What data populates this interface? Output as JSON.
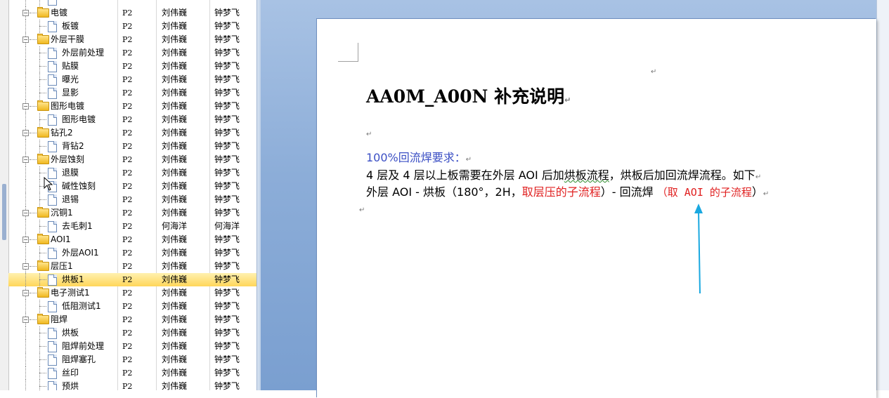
{
  "tree": {
    "rows": [
      {
        "label": "",
        "code": "",
        "owner": "",
        "reviewer": "",
        "level": 1,
        "type": "doc"
      },
      {
        "label": "电镀",
        "code": "P2",
        "owner": "刘伟巍",
        "reviewer": "钟梦飞",
        "level": 0,
        "type": "folder"
      },
      {
        "label": "板镀",
        "code": "P2",
        "owner": "刘伟巍",
        "reviewer": "钟梦飞",
        "level": 1,
        "type": "doc"
      },
      {
        "label": "外层干膜",
        "code": "P2",
        "owner": "刘伟巍",
        "reviewer": "钟梦飞",
        "level": 0,
        "type": "folder"
      },
      {
        "label": "外层前处理",
        "code": "P2",
        "owner": "刘伟巍",
        "reviewer": "钟梦飞",
        "level": 1,
        "type": "doc"
      },
      {
        "label": "贴膜",
        "code": "P2",
        "owner": "刘伟巍",
        "reviewer": "钟梦飞",
        "level": 1,
        "type": "doc"
      },
      {
        "label": "曝光",
        "code": "P2",
        "owner": "刘伟巍",
        "reviewer": "钟梦飞",
        "level": 1,
        "type": "doc"
      },
      {
        "label": "显影",
        "code": "P2",
        "owner": "刘伟巍",
        "reviewer": "钟梦飞",
        "level": 1,
        "type": "doc"
      },
      {
        "label": "图形电镀",
        "code": "P2",
        "owner": "刘伟巍",
        "reviewer": "钟梦飞",
        "level": 0,
        "type": "folder"
      },
      {
        "label": "图形电镀",
        "code": "P2",
        "owner": "刘伟巍",
        "reviewer": "钟梦飞",
        "level": 1,
        "type": "doc"
      },
      {
        "label": "钻孔2",
        "code": "P2",
        "owner": "刘伟巍",
        "reviewer": "钟梦飞",
        "level": 0,
        "type": "folder"
      },
      {
        "label": "背钻2",
        "code": "P2",
        "owner": "刘伟巍",
        "reviewer": "钟梦飞",
        "level": 1,
        "type": "doc"
      },
      {
        "label": "外层蚀刻",
        "code": "P2",
        "owner": "刘伟巍",
        "reviewer": "钟梦飞",
        "level": 0,
        "type": "folder"
      },
      {
        "label": "退膜",
        "code": "P2",
        "owner": "刘伟巍",
        "reviewer": "钟梦飞",
        "level": 1,
        "type": "doc"
      },
      {
        "label": "碱性蚀刻",
        "code": "P2",
        "owner": "刘伟巍",
        "reviewer": "钟梦飞",
        "level": 1,
        "type": "doc"
      },
      {
        "label": "退锡",
        "code": "P2",
        "owner": "刘伟巍",
        "reviewer": "钟梦飞",
        "level": 1,
        "type": "doc"
      },
      {
        "label": "沉铜1",
        "code": "P2",
        "owner": "刘伟巍",
        "reviewer": "钟梦飞",
        "level": 0,
        "type": "folder"
      },
      {
        "label": "去毛刺1",
        "code": "P2",
        "owner": "何海洋",
        "reviewer": "何海洋",
        "level": 1,
        "type": "doc"
      },
      {
        "label": "AOI1",
        "code": "P2",
        "owner": "刘伟巍",
        "reviewer": "钟梦飞",
        "level": 0,
        "type": "folder"
      },
      {
        "label": "外层AOI1",
        "code": "P2",
        "owner": "刘伟巍",
        "reviewer": "钟梦飞",
        "level": 1,
        "type": "doc"
      },
      {
        "label": "层压1",
        "code": "P2",
        "owner": "刘伟巍",
        "reviewer": "钟梦飞",
        "level": 0,
        "type": "folder"
      },
      {
        "label": "烘板1",
        "code": "P2",
        "owner": "刘伟巍",
        "reviewer": "钟梦飞",
        "level": 1,
        "type": "doc",
        "selected": true
      },
      {
        "label": "电子测试1",
        "code": "P2",
        "owner": "刘伟巍",
        "reviewer": "钟梦飞",
        "level": 0,
        "type": "folder"
      },
      {
        "label": "低阻测试1",
        "code": "P2",
        "owner": "刘伟巍",
        "reviewer": "钟梦飞",
        "level": 1,
        "type": "doc"
      },
      {
        "label": "阻焊",
        "code": "P2",
        "owner": "刘伟巍",
        "reviewer": "钟梦飞",
        "level": 0,
        "type": "folder"
      },
      {
        "label": "烘板",
        "code": "P2",
        "owner": "刘伟巍",
        "reviewer": "钟梦飞",
        "level": 1,
        "type": "doc"
      },
      {
        "label": "阻焊前处理",
        "code": "P2",
        "owner": "刘伟巍",
        "reviewer": "钟梦飞",
        "level": 1,
        "type": "doc"
      },
      {
        "label": "阻焊塞孔",
        "code": "P2",
        "owner": "刘伟巍",
        "reviewer": "钟梦飞",
        "level": 1,
        "type": "doc"
      },
      {
        "label": "丝印",
        "code": "P2",
        "owner": "刘伟巍",
        "reviewer": "钟梦飞",
        "level": 1,
        "type": "doc"
      },
      {
        "label": "预烘",
        "code": "P2",
        "owner": "刘伟巍",
        "reviewer": "钟梦飞",
        "level": 1,
        "type": "doc"
      }
    ]
  },
  "document": {
    "title": "AA0M_A00N 补充说明",
    "para_mark": "↵",
    "req_heading": "100%回流焊要求：",
    "line1_a": "4 层及 4 层以上板需要在外层 AOI 后加",
    "line1_wavy": "烘板流程",
    "line1_b": "，烘板后加回流焊流程。如下",
    "line2_a": "外层 AOI - 烘板（180°，2H，",
    "line2_red1": "取层压的子流程",
    "line2_b": "）- 回流焊",
    "line2_red2": "（取 AOI 的子流程",
    "line2_c": "）"
  },
  "colors": {
    "heading_blue": "#3b4fc4",
    "annotation_red": "#e02020",
    "arrow_cyan": "#1aa8e0",
    "selection_yellow": "#ffd65a"
  }
}
